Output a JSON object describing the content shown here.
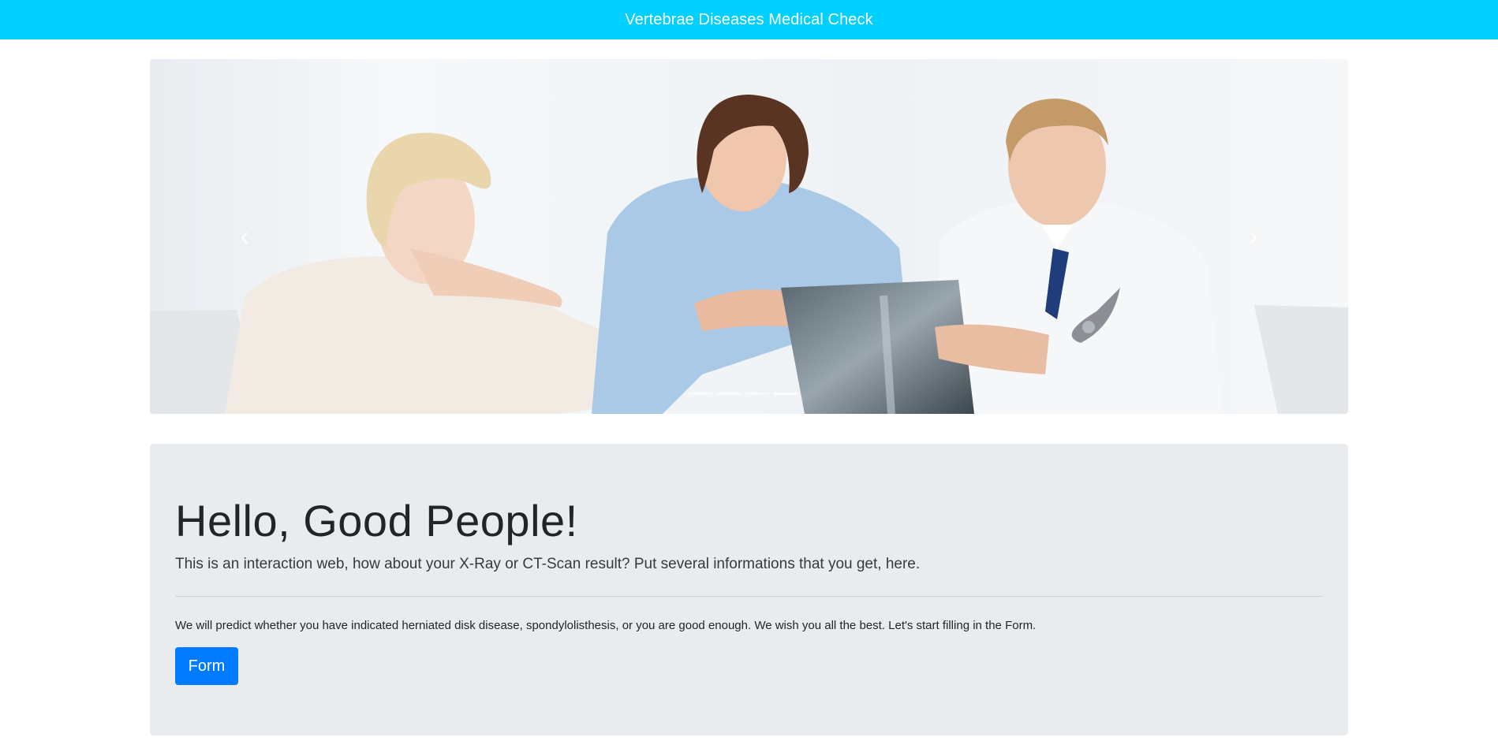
{
  "header": {
    "title": "Vertebrae Diseases Medical Check"
  },
  "carousel": {
    "prev_icon": "chevron-left-icon",
    "next_icon": "chevron-right-icon",
    "slide_count": 4,
    "active_slide": 4,
    "image_description_icon": "doctors-xray-photo"
  },
  "jumbotron": {
    "title": "Hello, Good People!",
    "lead": "This is an interaction web, how about your X-Ray or CT-Scan result? Put several informations that you get, here.",
    "body": "We will predict whether you have indicated herniated disk disease, spondylolisthesis, or you are good enough. We wish you all the best. Let's start filling in the Form.",
    "button_label": "Form"
  },
  "colors": {
    "header_bg": "#00d0ff",
    "jumbotron_bg": "#e9ecef",
    "primary_button": "#007bff"
  }
}
